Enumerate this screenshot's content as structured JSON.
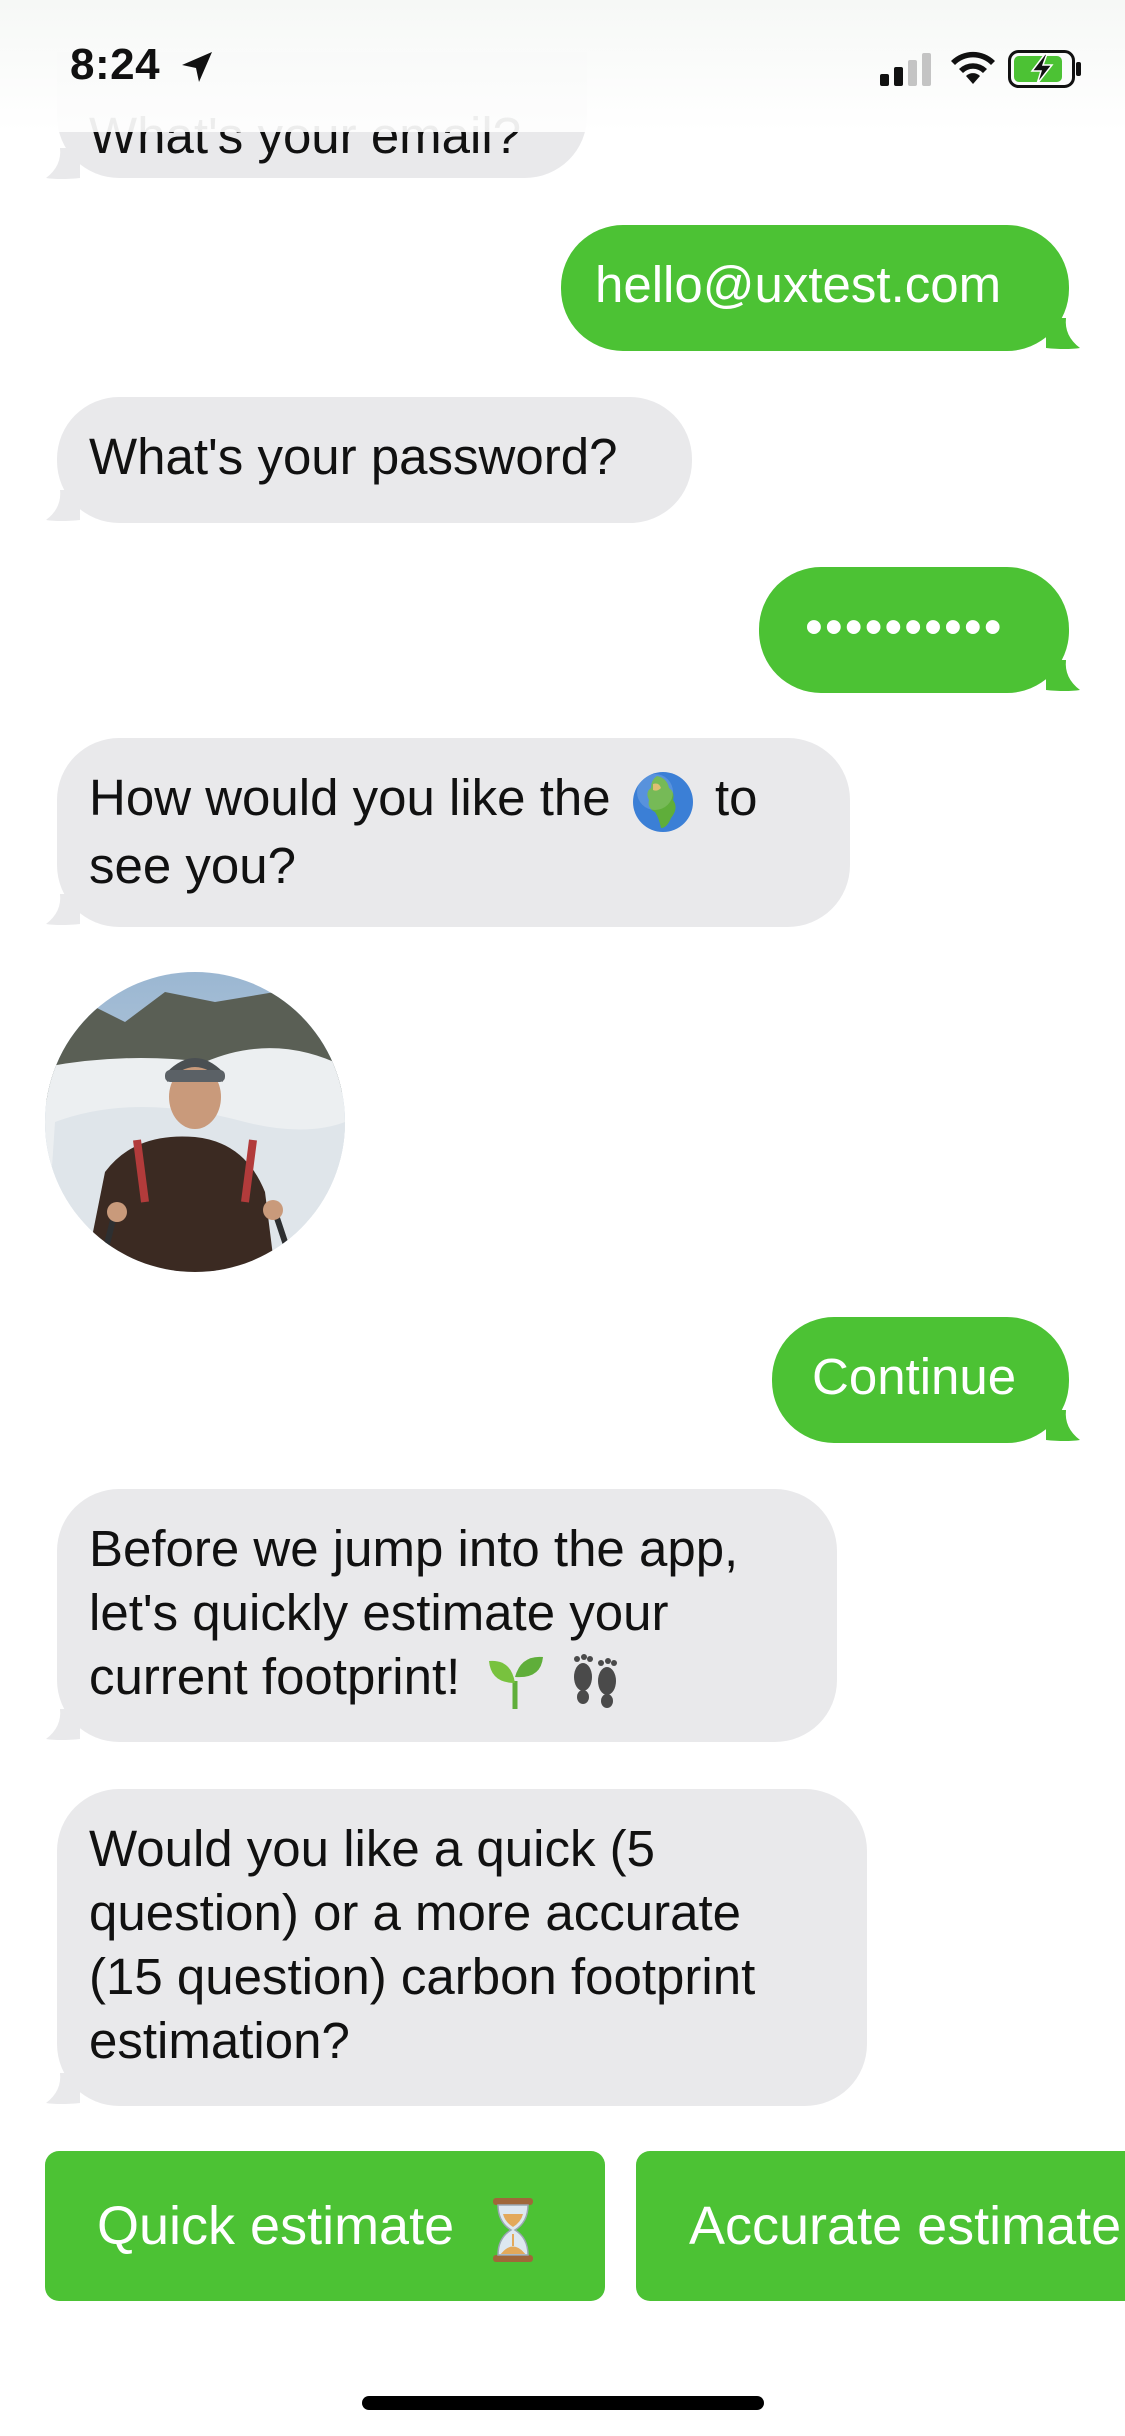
{
  "status_bar": {
    "time": "8:24",
    "icons": [
      "location-arrow-icon",
      "cellular-signal-icon",
      "wifi-icon",
      "battery-charging-icon"
    ]
  },
  "colors": {
    "accent": "#4cc234",
    "incoming_bubble": "#e9e9eb"
  },
  "messages": [
    {
      "from": "bot",
      "text": "What's your email?"
    },
    {
      "from": "user",
      "text": "hello@uxtest.com"
    },
    {
      "from": "bot",
      "text": "What's your password?"
    },
    {
      "from": "user",
      "text": "••••••••••"
    },
    {
      "from": "bot",
      "line1_a": "How would you like the",
      "line1_b": "to",
      "line2": "see you?",
      "emoji": "globe-africa-europe-icon"
    },
    {
      "from": "bot",
      "type": "image",
      "content": "profile-photo"
    },
    {
      "from": "user",
      "text": "Continue"
    },
    {
      "from": "bot",
      "line1": "Before we jump into the app,",
      "line2": "let's quickly estimate your",
      "line3": "current footprint!",
      "emoji": [
        "seedling-icon",
        "footprints-icon"
      ]
    },
    {
      "from": "bot",
      "line1": "Would you like a quick (5",
      "line2": "question) or a more accurate",
      "line3": "(15 question) carbon footprint",
      "line4": "estimation?"
    }
  ],
  "quick_replies": [
    {
      "label": "Quick estimate",
      "icon": "hourglass-icon"
    },
    {
      "label": "Accurate estimate"
    }
  ]
}
